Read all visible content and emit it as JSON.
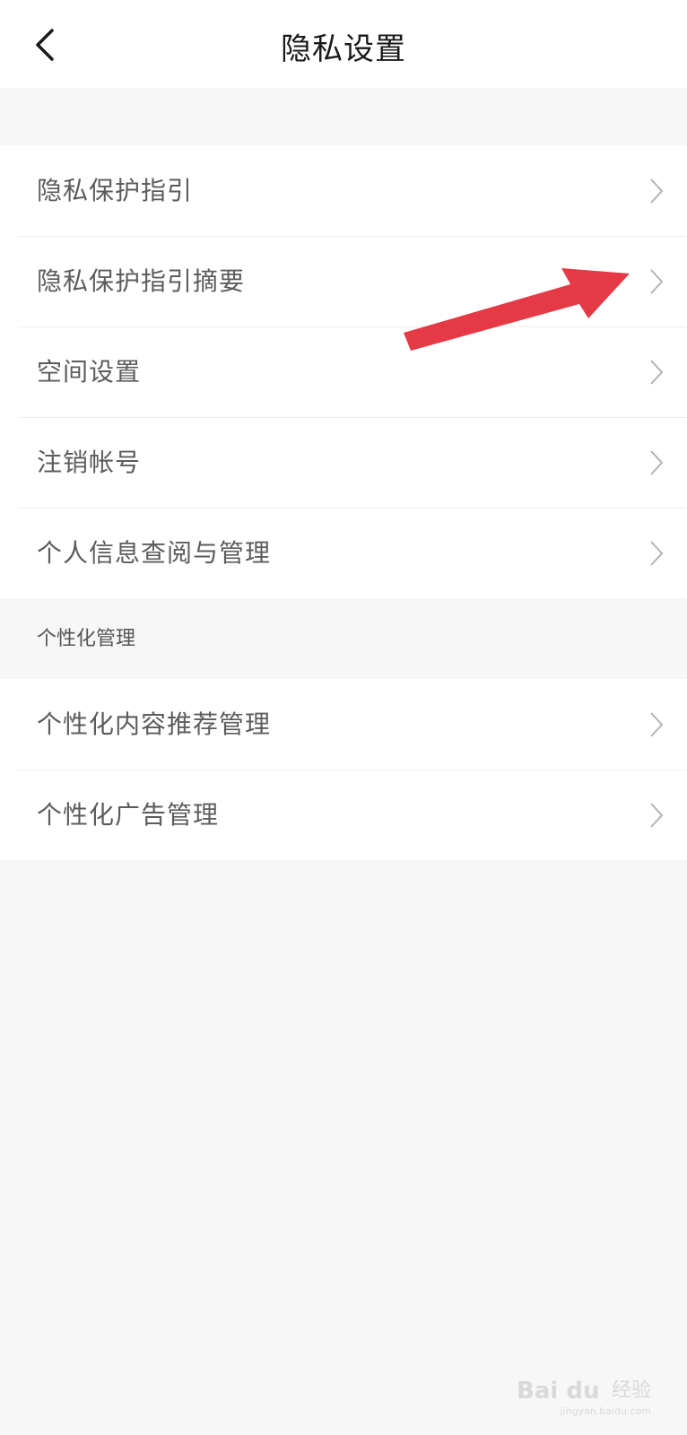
{
  "header": {
    "title": "隐私设置",
    "back_icon": "back-chevron-icon"
  },
  "sections": [
    {
      "items": [
        {
          "label": "隐私保护指引"
        },
        {
          "label": "隐私保护指引摘要"
        },
        {
          "label": "空间设置"
        },
        {
          "label": "注销帐号"
        },
        {
          "label": "个人信息查阅与管理"
        }
      ]
    },
    {
      "header": "个性化管理",
      "items": [
        {
          "label": "个性化内容推荐管理"
        },
        {
          "label": "个性化广告管理"
        }
      ]
    }
  ],
  "annotation": {
    "arrow_color": "#e63946"
  },
  "watermark": {
    "brand": "Bai du",
    "cn": "经验",
    "url": "jingyan.baidu.com"
  },
  "colors": {
    "background": "#f7f7f7",
    "card": "#ffffff",
    "title": "#1a1a1a",
    "label": "#5c5c5c",
    "chevron": "#b3b3b3"
  }
}
